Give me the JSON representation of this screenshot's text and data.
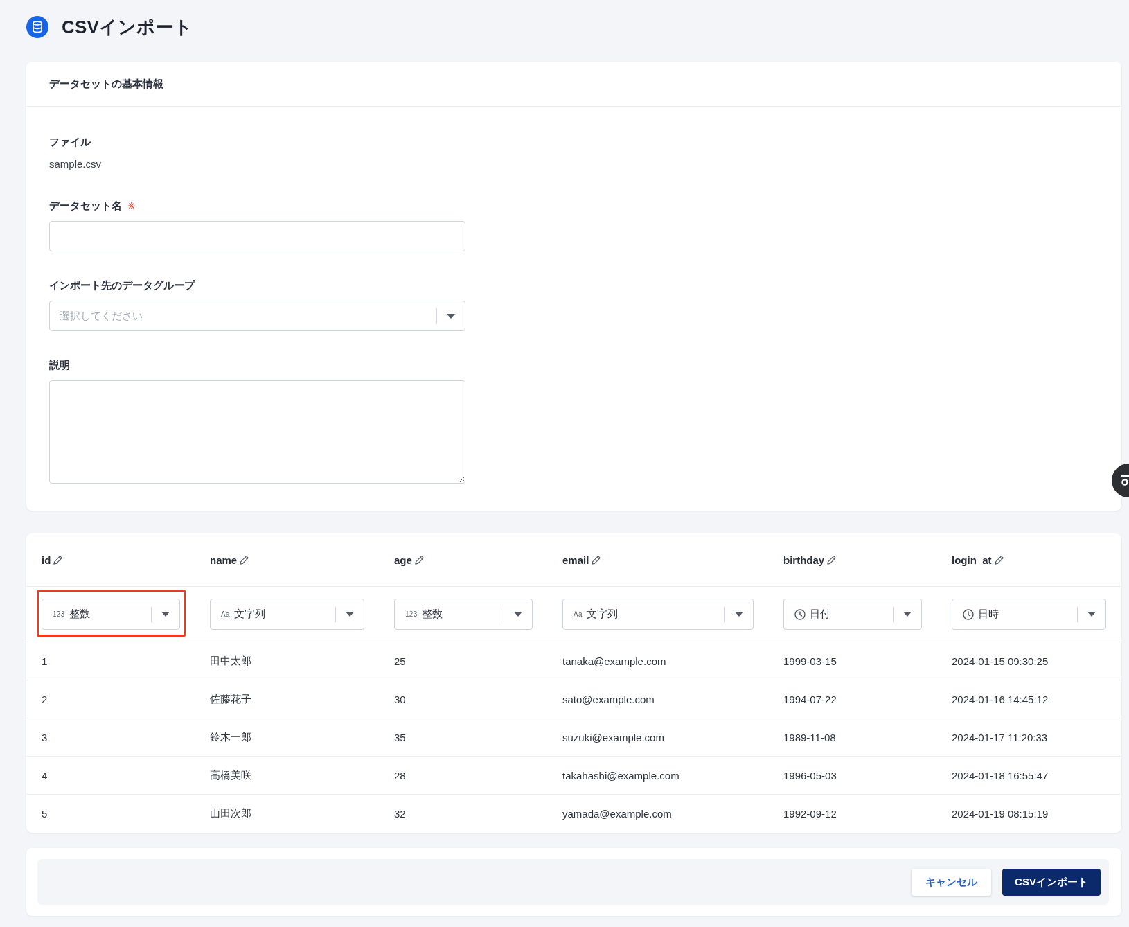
{
  "page": {
    "title": "CSVインポート"
  },
  "basic_info": {
    "title": "データセットの基本情報",
    "file": {
      "label": "ファイル",
      "value": "sample.csv"
    },
    "dataset_name": {
      "label": "データセット名",
      "required_mark": "※"
    },
    "data_group": {
      "label": "インポート先のデータグループ",
      "placeholder": "選択してください"
    },
    "description": {
      "label": "説明"
    }
  },
  "table": {
    "columns": [
      {
        "name": "id",
        "type": {
          "icon": {
            "kind": "glyph",
            "text": "123"
          },
          "label": "整数"
        },
        "highlighted": true
      },
      {
        "name": "name",
        "type": {
          "icon": {
            "kind": "glyph",
            "text": "Aa"
          },
          "label": "文字列"
        },
        "highlighted": false
      },
      {
        "name": "age",
        "type": {
          "icon": {
            "kind": "glyph",
            "text": "123"
          },
          "label": "整数"
        },
        "highlighted": false
      },
      {
        "name": "email",
        "type": {
          "icon": {
            "kind": "glyph",
            "text": "Aa"
          },
          "label": "文字列"
        },
        "highlighted": false
      },
      {
        "name": "birthday",
        "type": {
          "icon": {
            "kind": "clock"
          },
          "label": "日付"
        },
        "highlighted": false
      },
      {
        "name": "login_at",
        "type": {
          "icon": {
            "kind": "clock"
          },
          "label": "日時"
        },
        "highlighted": false
      }
    ],
    "rows": [
      [
        "1",
        "田中太郎",
        "25",
        "tanaka@example.com",
        "1999-03-15",
        "2024-01-15 09:30:25"
      ],
      [
        "2",
        "佐藤花子",
        "30",
        "sato@example.com",
        "1994-07-22",
        "2024-01-16 14:45:12"
      ],
      [
        "3",
        "鈴木一郎",
        "35",
        "suzuki@example.com",
        "1989-11-08",
        "2024-01-17 11:20:33"
      ],
      [
        "4",
        "高橋美咲",
        "28",
        "takahashi@example.com",
        "1996-05-03",
        "2024-01-18 16:55:47"
      ],
      [
        "5",
        "山田次郎",
        "32",
        "yamada@example.com",
        "1992-09-12",
        "2024-01-19 08:15:19"
      ]
    ]
  },
  "footer": {
    "buttons": [
      {
        "label": "キャンセル",
        "kind": "secondary"
      },
      {
        "label": "CSVインポート",
        "kind": "primary"
      }
    ]
  }
}
